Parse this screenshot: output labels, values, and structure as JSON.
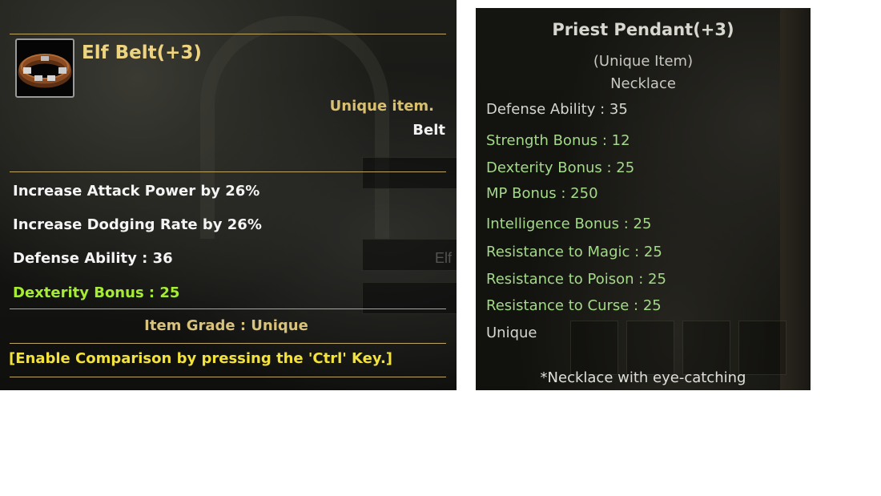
{
  "belt_tooltip": {
    "name": "Elf Belt(+3)",
    "rarity": "Unique item.",
    "type": "Belt",
    "stats": [
      {
        "text": "Increase Attack Power by 26%",
        "color": "#f4f4f4"
      },
      {
        "text": "Increase Dodging Rate by 26%",
        "color": "#f4f4f4"
      },
      {
        "text": "Defense Ability : 36",
        "color": "#f4f4f4"
      },
      {
        "text": "Dexterity Bonus : 25",
        "color": "#a6ec33"
      }
    ],
    "grade": "Item Grade : Unique",
    "compare_hint": "[Enable Comparison by pressing the 'Ctrl' Key.]",
    "background_ghost_label": "Elf",
    "icon": "belt-icon"
  },
  "pendant_tooltip": {
    "name": "Priest Pendant(+3)",
    "rarity": "(Unique Item)",
    "type": "Necklace",
    "defense": "Defense Ability : 35",
    "bonuses": [
      "Strength Bonus : 12",
      "Dexterity Bonus : 25",
      "MP Bonus : 250",
      "Intelligence Bonus : 25",
      "Resistance to Magic : 25",
      "Resistance to Poison : 25",
      "Resistance to Curse : 25"
    ],
    "grade": "Unique",
    "description": "*Necklace with eye-catching"
  },
  "colors": {
    "gold_title": "#eed480",
    "stat_green": "#a6ec33",
    "compare_yellow": "#f2e23a",
    "pendant_green": "#a4d98a"
  }
}
